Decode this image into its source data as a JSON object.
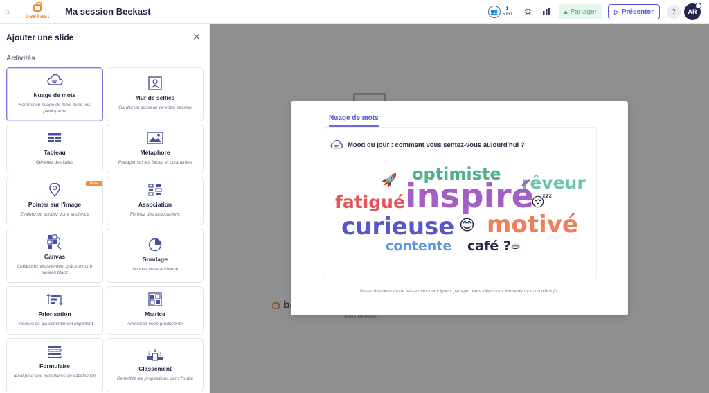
{
  "header": {
    "logo_text": "beekast",
    "session_title": "Ma session Beekast",
    "participants_current": "1",
    "participants_max": "5000",
    "share_label": "Partager",
    "present_label": "Présenter",
    "help_label": "?",
    "avatar_initials": "AR"
  },
  "sidebar": {
    "title": "Ajouter une slide",
    "section_label": "Activités",
    "cards": [
      {
        "name": "Nuage de mots",
        "desc": "Formez un nuage de mots avec vos participants",
        "icon": "cloud-icon"
      },
      {
        "name": "Mur de selfies",
        "desc": "Gardez un souvenir de votre session",
        "icon": "selfie-icon"
      },
      {
        "name": "Tableau",
        "desc": "Générez des idées",
        "icon": "table-icon"
      },
      {
        "name": "Métaphore",
        "desc": "Partager sur les forces et contraintes",
        "icon": "image-icon"
      },
      {
        "name": "Pointer sur l'image",
        "desc": "Evaluez ou sondez votre audience",
        "icon": "pin-icon",
        "badge": "Beta"
      },
      {
        "name": "Association",
        "desc": "Formez des associations",
        "icon": "association-icon"
      },
      {
        "name": "Canvas",
        "desc": "Collaborez visuellement grâce à notre tableau blanc",
        "icon": "canvas-icon"
      },
      {
        "name": "Sondage",
        "desc": "Sondez votre audience",
        "icon": "pie-icon"
      },
      {
        "name": "Priorisation",
        "desc": "Priorisez ce qui est vraiment important",
        "icon": "sort-icon"
      },
      {
        "name": "Matrice",
        "desc": "Améliorez votre productivité",
        "icon": "matrix-icon"
      },
      {
        "name": "Formulaire",
        "desc": "Idéal pour des formulaires de satisfaction",
        "icon": "form-icon"
      },
      {
        "name": "Classement",
        "desc": "Remettez les propositions dans l'ordre",
        "icon": "podium-icon"
      }
    ]
  },
  "background": {
    "logo_text": "be",
    "subtitle": "dans Beekast."
  },
  "modal": {
    "tab_label": "Nuage de mots",
    "question": "Mood du jour : comment vous sentez-vous aujourd'hui ?",
    "words": [
      {
        "text": "optimiste",
        "color": "#4fae8b"
      },
      {
        "text": "rêveur",
        "color": "#6cc1b0"
      },
      {
        "text": "fatigué",
        "color": "#e0565b"
      },
      {
        "text": "inspiré",
        "color": "#a45fc4"
      },
      {
        "text": "curieuse",
        "color": "#5856c9"
      },
      {
        "text": "motivé",
        "color": "#ef7f5a"
      },
      {
        "text": "contente",
        "color": "#5e98db"
      },
      {
        "text": "café ?",
        "color": "#23264a"
      }
    ],
    "emojis": [
      "🚀",
      "😴",
      "😊",
      "☕"
    ],
    "caption": "Posez une question et laissez vos participants partager leurs idées sous forme de mots ou d'émojis."
  }
}
